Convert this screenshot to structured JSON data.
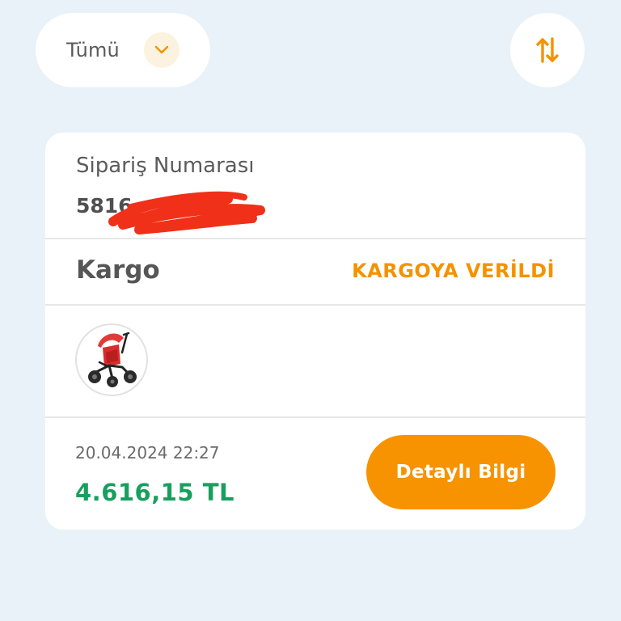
{
  "filter": {
    "label": "Tümü",
    "chevron_icon": "chevron-down-icon",
    "chevron_color": "#f49200"
  },
  "sort": {
    "icon": "sort-arrows-icon",
    "color": "#f49200"
  },
  "order": {
    "number_label": "Sipariş Numarası",
    "number_visible": "5816",
    "cargo_label": "Kargo",
    "cargo_status": "KARGOYA VERİLDİ",
    "product_image": "red-tricycle-stroller",
    "date": "20.04.2024 22:27",
    "total": "4.616,15 TL",
    "details_button_label": "Detaylı Bilgi"
  },
  "colors": {
    "background": "#e8f2f8",
    "accent": "#f79300",
    "total": "#17a05d",
    "redaction": "#f03018"
  }
}
